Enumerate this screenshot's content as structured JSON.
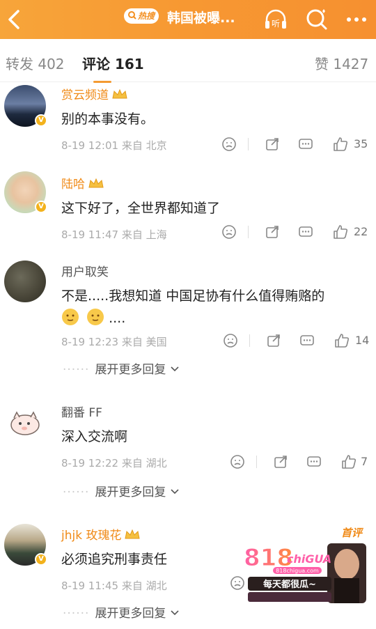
{
  "header": {
    "hot_label": "热搜",
    "title": "韩国被曝...",
    "listen_label": "听"
  },
  "tabs": [
    {
      "label": "转发",
      "count": "402"
    },
    {
      "label": "评论",
      "count": "161"
    },
    {
      "label": "赞",
      "count": "1427"
    }
  ],
  "comments": [
    {
      "user": "赏云频道",
      "text": "别的本事没有。",
      "time": "8-19 12:01",
      "from": "来自 北京",
      "likes": "35",
      "more": ""
    },
    {
      "user": "陆哈",
      "text": "这下好了，全世界都知道了",
      "time": "8-19 11:47",
      "from": "来自 上海",
      "likes": "22",
      "more": ""
    },
    {
      "user": "用户取笑",
      "text": "不是.....我想知道 中国足协有什么值得贿赂的",
      "text2": "....",
      "time": "8-19 12:23",
      "from": "来自 美国",
      "likes": "14",
      "more": "展开更多回复"
    },
    {
      "user": "翻番 FF",
      "text": "深入交流啊",
      "time": "8-19 12:22",
      "from": "来自 湖北",
      "likes": "7",
      "more": "展开更多回复"
    },
    {
      "user": "jhjk 玫瑰花",
      "text": "必须追究刑事责任",
      "time": "8-19 11:45",
      "from": "来自 湖北",
      "likes": "",
      "more": "展开更多回复",
      "badge": "首评"
    }
  ],
  "watermark": {
    "brand": "818chiGUA",
    "site": "818chigua.com",
    "slogan": "每天都很瓜~"
  },
  "colors": {
    "header": "#f79832",
    "vip_name": "#f08b19",
    "badge": "#f3b21c"
  }
}
